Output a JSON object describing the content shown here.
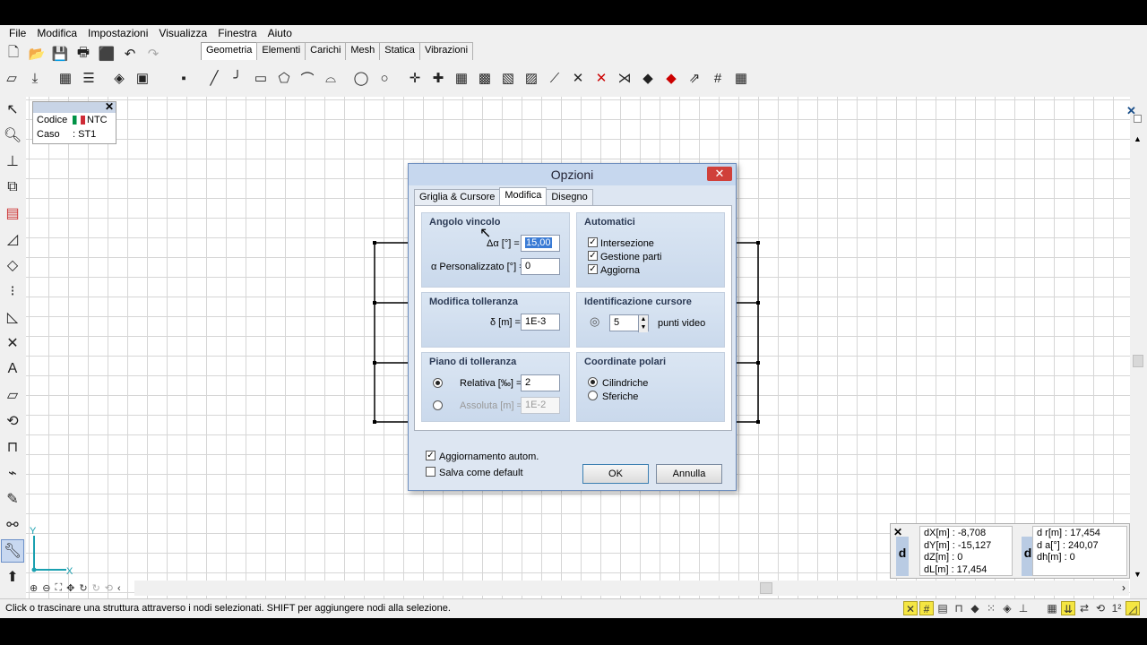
{
  "menu": [
    "File",
    "Modifica",
    "Impostazioni",
    "Visualizza",
    "Finestra",
    "Aiuto"
  ],
  "tabs": [
    "Geometria",
    "Elementi",
    "Carichi",
    "Mesh",
    "Statica",
    "Vibrazioni"
  ],
  "infobox": {
    "codice_label": "Codice",
    "codice_value": "NTC",
    "caso_label": "Caso",
    "caso_value": ": ST1"
  },
  "axes": {
    "y": "Y",
    "x": "X"
  },
  "dialog": {
    "title": "Opzioni",
    "tabs": [
      "Griglia & Cursore",
      "Modifica",
      "Disegno"
    ],
    "angolo": {
      "title": "Angolo vincolo",
      "delta_label": "Δα [°] =",
      "delta_value": "15,00",
      "pers_label": "α Personalizzato [°] =",
      "pers_value": "0"
    },
    "automatici": {
      "title": "Automatici",
      "items": [
        "Intersezione",
        "Gestione parti",
        "Aggiorna"
      ]
    },
    "tolleranza": {
      "title": "Modifica tolleranza",
      "label": "δ [m] =",
      "value": "1E-3"
    },
    "cursore": {
      "title": "Identificazione cursore",
      "value": "5",
      "unit": "punti video"
    },
    "piano": {
      "title": "Piano di tolleranza",
      "rel_label": "Relativa [‰] =",
      "rel_value": "2",
      "ass_label": "Assoluta [m] =",
      "ass_value": "1E-2"
    },
    "polari": {
      "title": "Coordinate polari",
      "opt1": "Cilindriche",
      "opt2": "Sferiche"
    },
    "aggiornamento": "Aggiornamento autom.",
    "salva": "Salva come default",
    "ok": "OK",
    "annulla": "Annulla"
  },
  "coords": {
    "d": "d",
    "left": [
      "dX[m] : -8,708",
      "dY[m] : -15,127",
      "dZ[m] : 0",
      "dL[m] : 17,454"
    ],
    "right": [
      "d r[m] : 17,454",
      "d a[°] : 240,07",
      "dh[m] : 0"
    ]
  },
  "status": "Click o trascinare una struttura attraverso i nodi selezionati. SHIFT per aggiungere nodi alla selezione.",
  "status_right": "1²"
}
